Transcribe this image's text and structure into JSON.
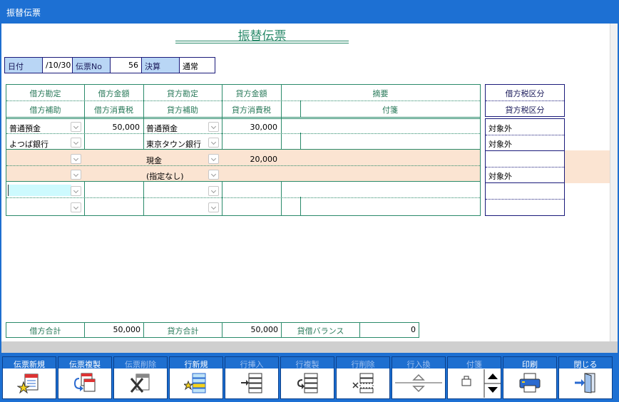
{
  "window": {
    "title": "振替伝票"
  },
  "doc_title": "振替伝票",
  "header": {
    "date_label": "日付",
    "date_value": "/10/30",
    "voucher_no_label": "伝票No",
    "voucher_no_value": "56",
    "settlement_label": "決算",
    "settlement_value": "通常"
  },
  "columns": {
    "debit_account": "借方勘定",
    "debit_amount": "借方金額",
    "credit_account": "貸方勘定",
    "credit_amount": "貸方金額",
    "summary": "摘要",
    "debit_sub": "借方補助",
    "debit_tax": "借方消費税",
    "credit_sub": "貸方補助",
    "credit_tax": "貸方消費税",
    "tag": "付箋",
    "debit_tax_class": "借方税区分",
    "credit_tax_class": "貸方税区分"
  },
  "entries": [
    {
      "debit_account": "普通預金",
      "debit_sub": "よつば銀行",
      "debit_amount": "50,000",
      "debit_tax": "",
      "credit_account": "普通預金",
      "credit_sub": "東京タウン銀行",
      "credit_amount": "30,000",
      "credit_tax": "",
      "debit_tax_class": "対象外",
      "credit_tax_class": "対象外"
    },
    {
      "debit_account": "",
      "debit_sub": "",
      "debit_amount": "",
      "debit_tax": "",
      "credit_account": "現金",
      "credit_sub": "(指定なし)",
      "credit_amount": "20,000",
      "credit_tax": "",
      "debit_tax_class": "",
      "credit_tax_class": "対象外"
    },
    {
      "debit_account": "",
      "debit_sub": "",
      "debit_amount": "",
      "debit_tax": "",
      "credit_account": "",
      "credit_sub": "",
      "credit_amount": "",
      "credit_tax": "",
      "debit_tax_class": "",
      "credit_tax_class": ""
    }
  ],
  "totals": {
    "debit_label": "借方合計",
    "debit_value": "50,000",
    "credit_label": "貸方合計",
    "credit_value": "50,000",
    "balance_label": "貸借バランス",
    "balance_value": "0"
  },
  "toolbar": [
    {
      "label": "伝票新規",
      "icon": "new-voucher-icon",
      "enabled": true
    },
    {
      "label": "伝票複製",
      "icon": "copy-voucher-icon",
      "enabled": true
    },
    {
      "label": "伝票削除",
      "icon": "delete-voucher-icon",
      "enabled": false
    },
    {
      "label": "行新規",
      "icon": "new-row-icon",
      "enabled": true
    },
    {
      "label": "行挿入",
      "icon": "insert-row-icon",
      "enabled": false
    },
    {
      "label": "行複製",
      "icon": "copy-row-icon",
      "enabled": false
    },
    {
      "label": "行削除",
      "icon": "delete-row-icon",
      "enabled": false
    },
    {
      "label": "行入換",
      "icon": "swap-row-icon",
      "enabled": false
    },
    {
      "label": "付箋",
      "icon": "tag-icon",
      "enabled": false
    },
    {
      "label": "印刷",
      "icon": "printer-icon",
      "enabled": true
    },
    {
      "label": "閉じる",
      "icon": "exit-door-icon",
      "enabled": true
    }
  ],
  "colors": {
    "accent": "#1d70d3",
    "grid_line": "#2a8a6a",
    "row_band": "#fbe4d2",
    "label_bg": "#b9d6f5"
  }
}
